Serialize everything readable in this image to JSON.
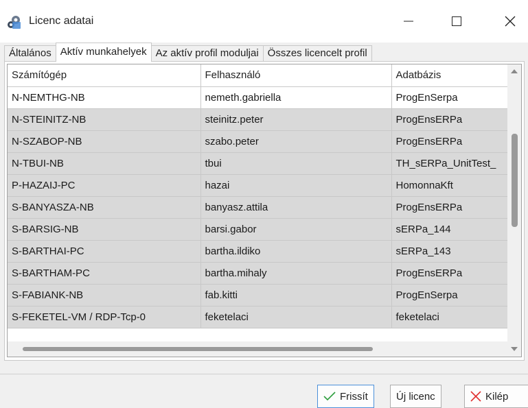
{
  "window": {
    "title": "Licenc adatai"
  },
  "tabs": [
    {
      "label": "Általános",
      "active": false
    },
    {
      "label": "Aktív munkahelyek",
      "active": true
    },
    {
      "label": "Az aktív profil moduljai",
      "active": false
    },
    {
      "label": "Összes licencelt profil",
      "active": false
    }
  ],
  "grid": {
    "columns": [
      "Számítógép",
      "Felhasználó",
      "Adatbázis"
    ],
    "rows": [
      [
        "N-NEMTHG-NB",
        "nemeth.gabriella",
        "ProgEnSerpa"
      ],
      [
        "N-STEINITZ-NB",
        "steinitz.peter",
        "ProgEnsERPa"
      ],
      [
        "N-SZABOP-NB",
        "szabo.peter",
        "ProgEnsERPa"
      ],
      [
        "N-TBUI-NB",
        "tbui",
        "TH_sERPa_UnitTest_"
      ],
      [
        "P-HAZAIJ-PC",
        "hazai",
        "HomonnaKft"
      ],
      [
        "S-BANYASZA-NB",
        "banyasz.attila",
        "ProgEnsERPa"
      ],
      [
        "S-BARSIG-NB",
        "barsi.gabor",
        "sERPa_144"
      ],
      [
        "S-BARTHAI-PC",
        "bartha.ildiko",
        "sERPa_143"
      ],
      [
        "S-BARTHAM-PC",
        "bartha.mihaly",
        "ProgEnsERPa"
      ],
      [
        "S-FABIANK-NB",
        "fab.kitti",
        "ProgEnSerpa"
      ],
      [
        "S-FEKETEL-VM / RDP-Tcp-0",
        "feketelaci",
        "feketelaci"
      ]
    ]
  },
  "buttons": {
    "refresh": "Frissít",
    "new_license": "Új licenc",
    "exit": "Kilép"
  },
  "colors": {
    "refresh_check": "#2e9e3e",
    "exit_x": "#e03030",
    "row_alt": "#d9d9d9"
  }
}
